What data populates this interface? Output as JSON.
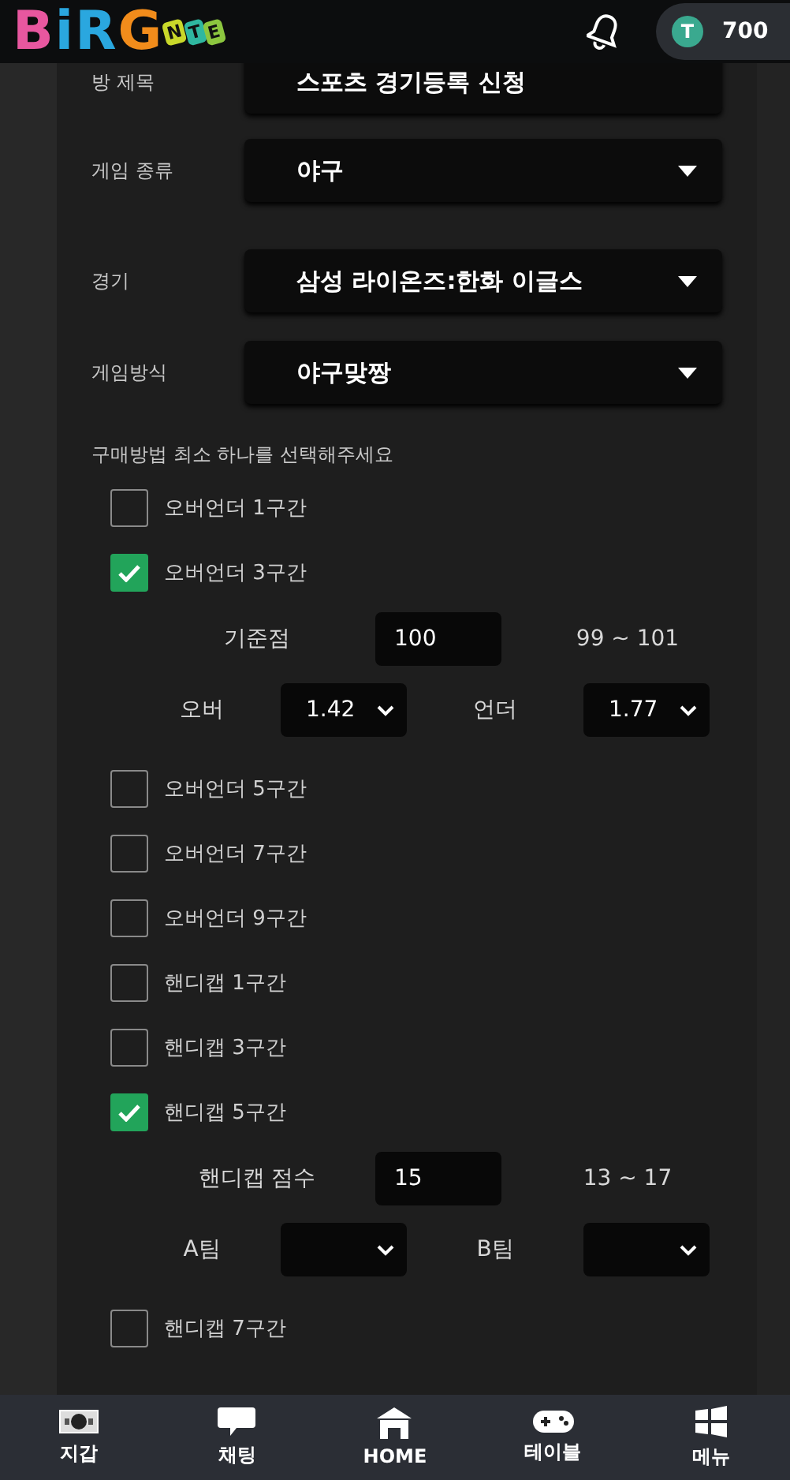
{
  "header": {
    "logo": [
      {
        "text": "B",
        "color": "#e8579f"
      },
      {
        "text": "i",
        "color": "#2aa7df"
      },
      {
        "text": "R",
        "color": "#2aa7df"
      },
      {
        "text": "G",
        "color": "#f28c1b"
      },
      {
        "text": "N",
        "color": "#c9d82a"
      },
      {
        "text": "T",
        "color": "#2fb7a0"
      },
      {
        "text": "E",
        "color": "#8cc63f"
      }
    ],
    "coin": {
      "symbol": "T",
      "amount": "700"
    }
  },
  "form": [
    {
      "label": "방 제목",
      "kind": "text",
      "value": "스포츠 경기등록 신청"
    },
    {
      "label": "게임 종류",
      "kind": "select",
      "value": "야구"
    },
    {
      "label": "경기",
      "kind": "select",
      "value": "삼성 라이온즈:한화 이글스"
    },
    {
      "label": "게임방식",
      "kind": "select",
      "value": "야구맞짱"
    }
  ],
  "instruction": "구매방법 최소 하나를 선택해주세요",
  "options": [
    {
      "label": "오버언더 1구간",
      "checked": false
    },
    {
      "label": "오버언더 3구간",
      "checked": true,
      "settings": {
        "score_label": "기준점",
        "score": "100",
        "range": "99 ~ 101",
        "selects": [
          {
            "label": "오버",
            "value": "1.42"
          },
          {
            "label": "언더",
            "value": "1.77"
          }
        ]
      }
    },
    {
      "label": "오버언더 5구간",
      "checked": false
    },
    {
      "label": "오버언더 7구간",
      "checked": false
    },
    {
      "label": "오버언더 9구간",
      "checked": false
    },
    {
      "label": "핸디캡 1구간",
      "checked": false
    },
    {
      "label": "핸디캡 3구간",
      "checked": false
    },
    {
      "label": "핸디캡 5구간",
      "checked": true,
      "settings": {
        "score_label": "핸디캡 점수",
        "score": "15",
        "range": "13 ~ 17",
        "selects": [
          {
            "label": "A팀"
          },
          {
            "label": "B팀"
          }
        ]
      }
    },
    {
      "label": "핸디캡 7구간",
      "checked": false
    }
  ],
  "nav": [
    {
      "label": "지갑",
      "kind": "wallet"
    },
    {
      "label": "채팅",
      "kind": "chat"
    },
    {
      "label": "HOME",
      "kind": "home"
    },
    {
      "label": "테이블",
      "kind": "game"
    },
    {
      "label": "메뉴",
      "kind": "menu"
    }
  ]
}
